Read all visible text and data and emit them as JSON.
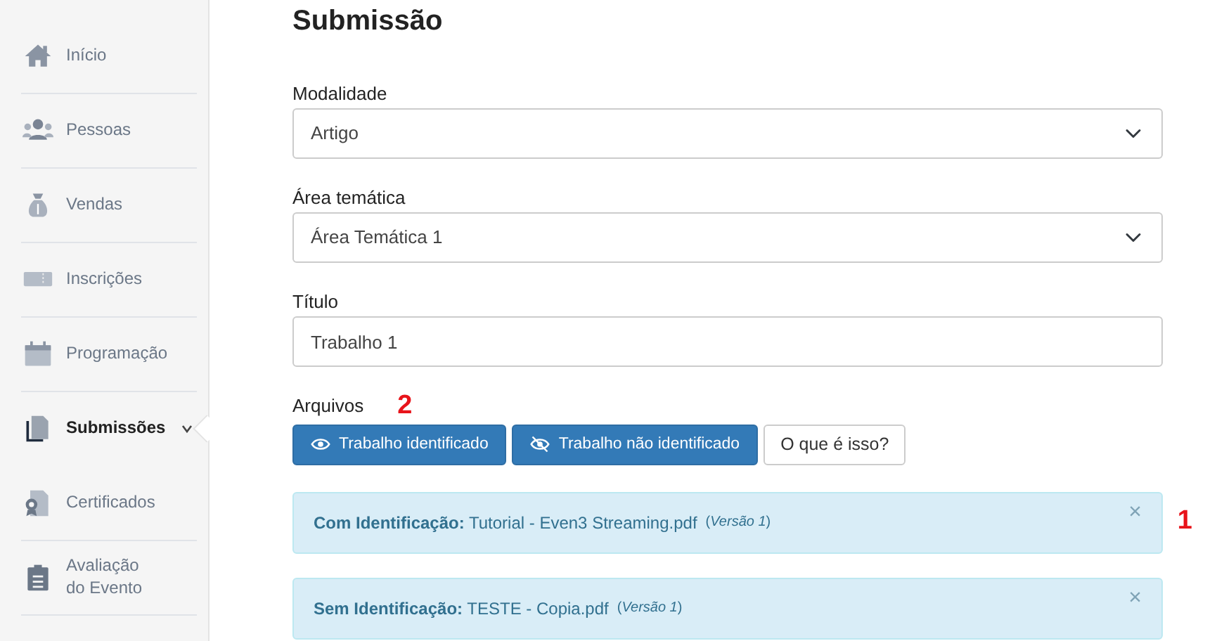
{
  "sidebar": {
    "items": [
      {
        "label": "Início",
        "selected": false
      },
      {
        "label": "Pessoas",
        "selected": false
      },
      {
        "label": "Vendas",
        "selected": false
      },
      {
        "label": "Inscrições",
        "selected": false
      },
      {
        "label": "Programação",
        "selected": false
      },
      {
        "label": "Submissões",
        "selected": true,
        "expanded": false
      },
      {
        "label": "Certificados",
        "selected": false
      },
      {
        "label": "Avaliação do Evento",
        "selected": false
      }
    ]
  },
  "page_title": "Submissão",
  "fields": [
    {
      "kind": "select",
      "label": "Modalidade",
      "value": "Artigo"
    },
    {
      "kind": "select",
      "label": "Área temática",
      "value": "Área Temática 1"
    },
    {
      "kind": "text",
      "label": "Título",
      "value": "Trabalho 1"
    }
  ],
  "files": {
    "label": "Arquivos",
    "annotation": "2",
    "buttons": [
      {
        "kind": "primary",
        "label": "Trabalho identificado"
      },
      {
        "kind": "primary",
        "label": "Trabalho não identificado"
      },
      {
        "kind": "outline",
        "label": "O que é isso?"
      }
    ]
  },
  "alerts": [
    {
      "text": "**Com Identificação:** Tutorial - Even3 Streaming.pdf",
      "version": "(*Versão 1*)",
      "close": "×",
      "annotation": "1"
    },
    {
      "text": "**Sem Identificação:** TESTE - Copia.pdf",
      "version": "(*Versão 1*)",
      "close": "×"
    }
  ]
}
